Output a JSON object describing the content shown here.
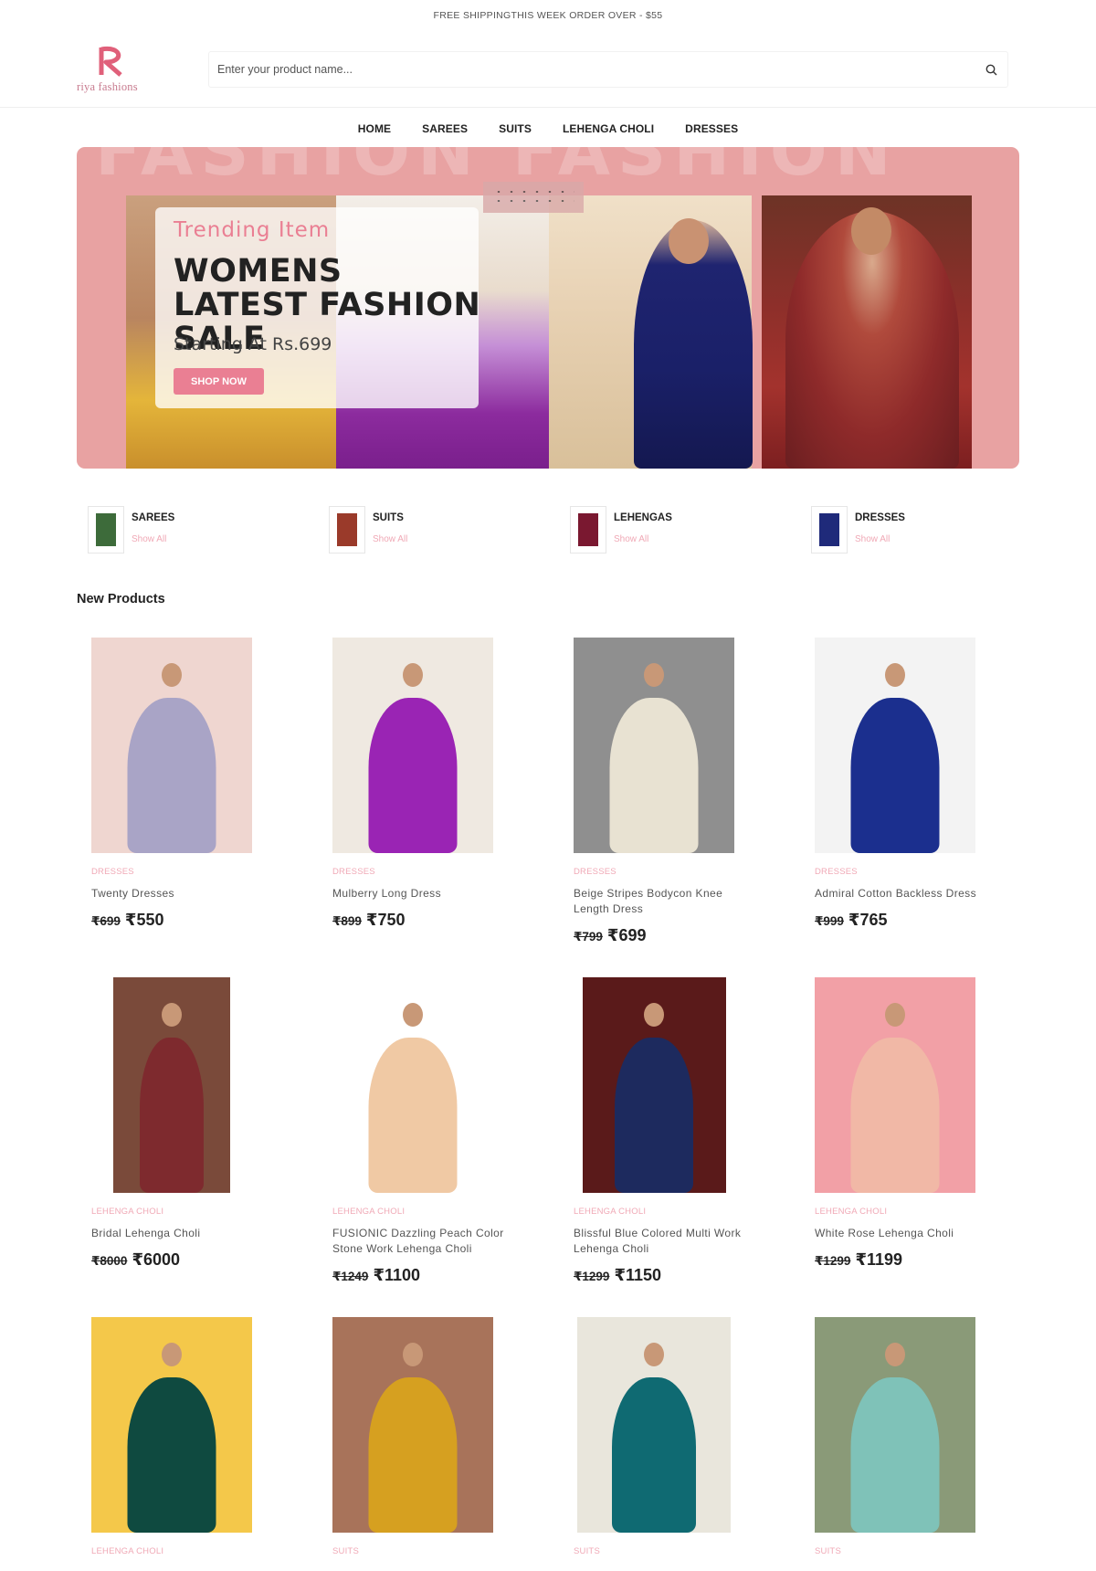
{
  "topbar": {
    "text": "FREE SHIPPINGTHIS WEEK ORDER OVER - $55"
  },
  "header": {
    "logo_text": "riya fashions",
    "search_placeholder": "Enter your product name..."
  },
  "nav": [
    "HOME",
    "SAREES",
    "SUITS",
    "LEHENGA CHOLI",
    "DRESSES"
  ],
  "hero": {
    "background_text": "FASHION FASHION",
    "kicker": "Trending Item",
    "title": "WOMENS LATEST FASHION SALE",
    "subtitle": "Starting At Rs.699",
    "button": "SHOP NOW"
  },
  "categories": [
    {
      "name": "SAREES",
      "link": "Show All",
      "color": "#3d6b3a"
    },
    {
      "name": "SUITS",
      "link": "Show All",
      "color": "#9a3a2a"
    },
    {
      "name": "LEHENGAS",
      "link": "Show All",
      "color": "#7a1830"
    },
    {
      "name": "DRESSES",
      "link": "Show All",
      "color": "#1f2a7a"
    }
  ],
  "section_title": "New Products",
  "products": [
    {
      "category": "DRESSES",
      "name": "Twenty Dresses",
      "old_price": "₹699",
      "price": "₹550",
      "bg": "#efd6d0",
      "dress": "#a9a4c6"
    },
    {
      "category": "DRESSES",
      "name": "Mulberry Long Dress",
      "old_price": "₹899",
      "price": "₹750",
      "bg": "#efe9e1",
      "dress": "#9a24b4"
    },
    {
      "category": "DRESSES",
      "name": "Beige Stripes Bodycon Knee Length Dress",
      "old_price": "₹799",
      "price": "₹699",
      "bg": "#8f8f8f",
      "dress": "#e8e2d2"
    },
    {
      "category": "DRESSES",
      "name": "Admiral Cotton Backless Dress",
      "old_price": "₹999",
      "price": "₹765",
      "bg": "#f3f3f3",
      "dress": "#1b2f8e"
    },
    {
      "category": "LEHENGA CHOLI",
      "name": "Bridal Lehenga Choli",
      "old_price": "₹8000",
      "price": "₹6000",
      "bg": "#7a4a3a",
      "dress": "#7e2a2e"
    },
    {
      "category": "LEHENGA CHOLI",
      "name": "FUSIONIC Dazzling Peach Color Stone Work Lehenga Choli",
      "old_price": "₹1249",
      "price": "₹1100",
      "bg": "#ffffff",
      "dress": "#f0c9a4"
    },
    {
      "category": "LEHENGA CHOLI",
      "name": "Blissful Blue Colored Multi Work Lehenga Choli",
      "old_price": "₹1299",
      "price": "₹1150",
      "bg": "#5a1a1a",
      "dress": "#1d2a5e"
    },
    {
      "category": "LEHENGA CHOLI",
      "name": "White Rose Lehenga Choli",
      "old_price": "₹1299",
      "price": "₹1199",
      "bg": "#f2a0a6",
      "dress": "#f1b8a6"
    },
    {
      "category": "LEHENGA CHOLI",
      "name": "",
      "old_price": "",
      "price": "",
      "bg": "#f4c84a",
      "dress": "#0f4a40"
    },
    {
      "category": "SUITS",
      "name": "",
      "old_price": "",
      "price": "",
      "bg": "#a8735a",
      "dress": "#d6a020"
    },
    {
      "category": "SUITS",
      "name": "",
      "old_price": "",
      "price": "",
      "bg": "#e9e6dc",
      "dress": "#0f6a72"
    },
    {
      "category": "SUITS",
      "name": "",
      "old_price": "",
      "price": "",
      "bg": "#8a9a78",
      "dress": "#7fc2b8"
    }
  ],
  "colors": {
    "accent": "#ea7f93",
    "hero_bg": "#e8a2a2",
    "category_link": "#f0a9b6"
  }
}
